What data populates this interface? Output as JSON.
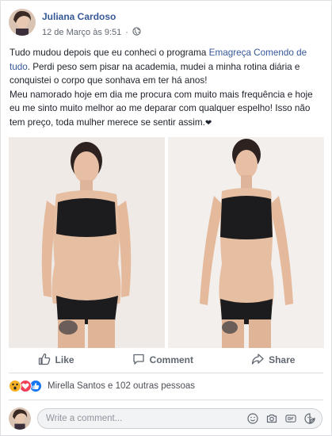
{
  "post": {
    "author": "Juliana Cardoso",
    "timestamp": "12 de Março às 9:51",
    "separator": "·",
    "audience_icon": "globe-icon",
    "text_p1_before_link": "Tudo mudou depois que eu conheci o programa ",
    "text_p1_link": "Emagreça Comendo de tudo",
    "text_p1_after_link": ". Perdi peso sem pisar na academia, mudei a minha rotina diária e conquistei o corpo que sonhava em ter há anos!",
    "text_p2": "Meu namorado hoje em dia me procura com muito mais frequência e hoje eu me sinto muito melhor ao me deparar com qualquer espelho! Isso não tem preço, toda mulher merece se sentir assim.",
    "text_p2_end": "❤",
    "photos": [
      "before-photo",
      "after-photo"
    ]
  },
  "actions": {
    "like_label": "Like",
    "comment_label": "Comment",
    "share_label": "Share"
  },
  "reactions": {
    "icons": [
      "wow-reaction-icon",
      "love-reaction-icon",
      "like-reaction-icon"
    ],
    "summary": "Mirella Santos e 102 outras pessoas"
  },
  "comment_box": {
    "placeholder": "Write a comment..."
  },
  "colors": {
    "link": "#365899",
    "secondary_text": "#606770",
    "divider": "#dadde1",
    "like_blue": "#1877f2",
    "love_red": "#f33e58",
    "wow_yellow": "#f7b125"
  }
}
